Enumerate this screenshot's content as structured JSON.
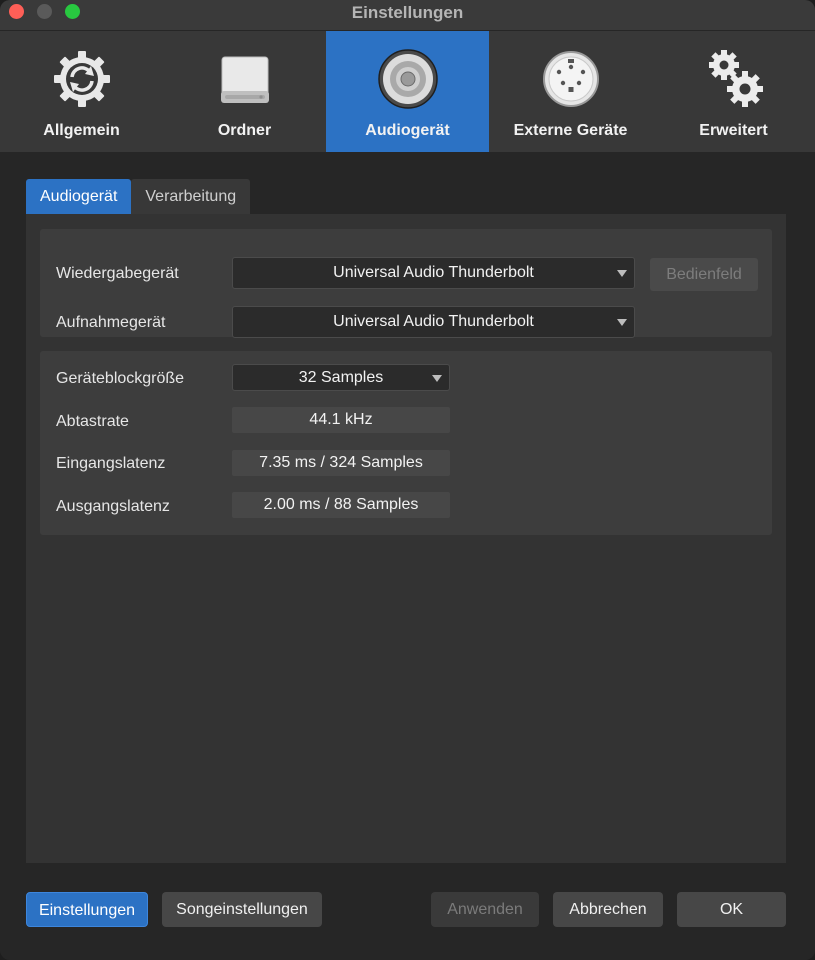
{
  "window": {
    "title": "Einstellungen"
  },
  "toolbar": {
    "items": [
      {
        "label": "Allgemein",
        "icon": "sync-gear-icon"
      },
      {
        "label": "Ordner",
        "icon": "drive-icon"
      },
      {
        "label": "Audiogerät",
        "icon": "speaker-icon"
      },
      {
        "label": "Externe Geräte",
        "icon": "midi-port-icon"
      },
      {
        "label": "Erweitert",
        "icon": "gears-icon"
      }
    ],
    "active_index": 2
  },
  "subtabs": [
    "Audiogerät",
    "Verarbeitung"
  ],
  "devices": {
    "playback_label": "Wiedergabegerät",
    "playback_value": "Universal Audio Thunderbolt",
    "control_panel_label": "Bedienfeld",
    "record_label": "Aufnahmegerät",
    "record_value": "Universal Audio Thunderbolt"
  },
  "settings": {
    "blocksize_label": "Geräteblockgröße",
    "blocksize_value": "32 Samples",
    "samplerate_label": "Abtastrate",
    "samplerate_value": "44.1 kHz",
    "input_latency_label": "Eingangslatenz",
    "input_latency_value": "7.35 ms / 324 Samples",
    "output_latency_label": "Ausgangslatenz",
    "output_latency_value": "2.00 ms / 88 Samples"
  },
  "footer": {
    "settings_label": "Einstellungen",
    "song_settings_label": "Songeinstellungen",
    "apply_label": "Anwenden",
    "cancel_label": "Abbrechen",
    "ok_label": "OK"
  },
  "colors": {
    "accent": "#2c72c4",
    "close": "#fe5f57",
    "maximize": "#28c840"
  }
}
